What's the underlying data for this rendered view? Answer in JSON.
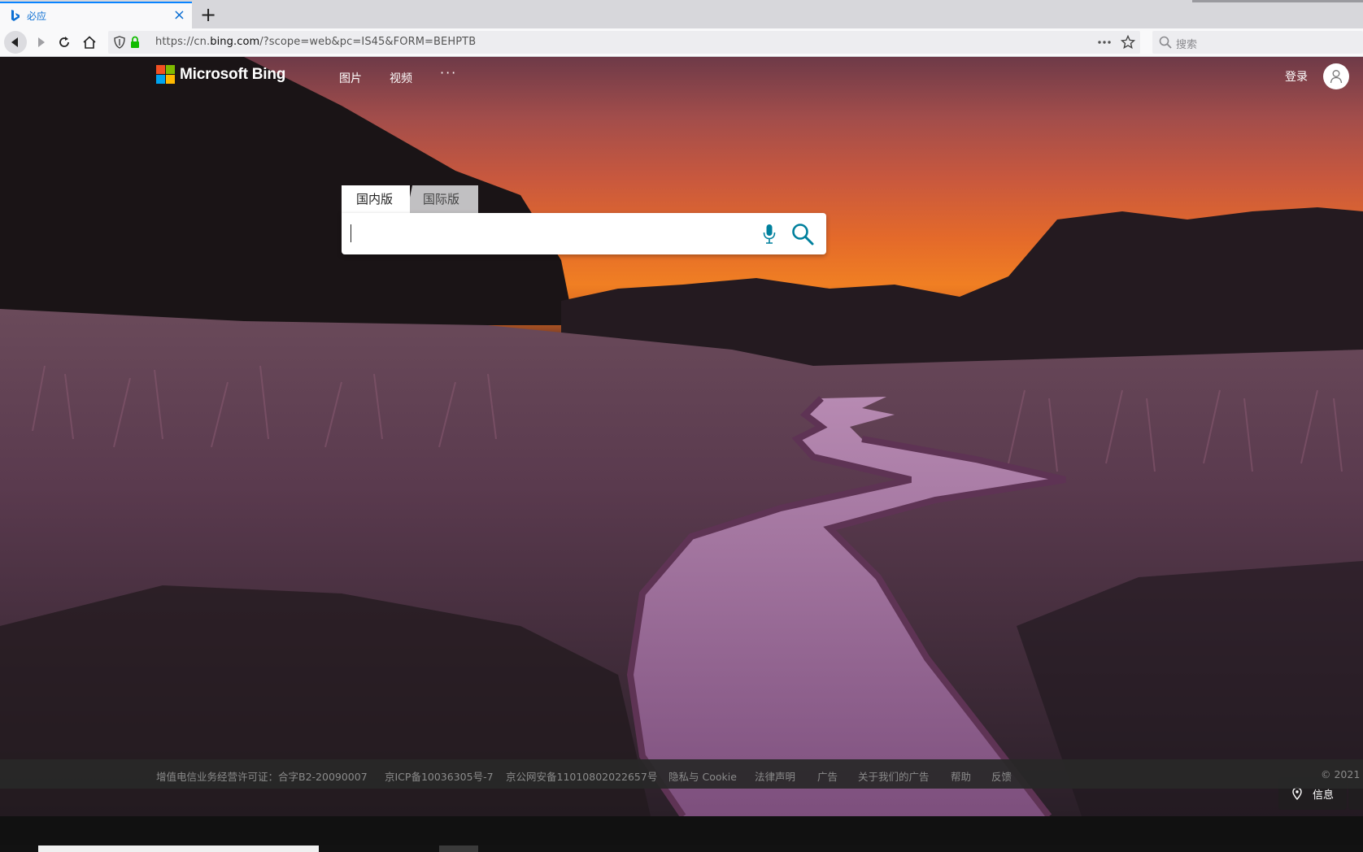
{
  "browser": {
    "tab_title": "必应",
    "tab_close": "×",
    "new_tab": "+",
    "url_prefix": "https://cn.",
    "url_host": "bing.com",
    "url_path": "/?scope=web&pc=IS45&FORM=BEHPTB",
    "search_placeholder": "搜索",
    "accent_color": "#0a84ff"
  },
  "bing": {
    "logo_text": "Microsoft Bing",
    "logo_colors": [
      "#f25022",
      "#7fba00",
      "#00a4ef",
      "#ffb900"
    ],
    "nav": {
      "images": "图片",
      "videos": "视频",
      "more": "···"
    },
    "signin": "登录",
    "scope_tabs": {
      "domestic": "国内版",
      "international": "国际版"
    },
    "search_value": "",
    "accent_color": "#00809d"
  },
  "info_button": "信息",
  "footer": {
    "license": "增值电信业务经营许可证：合字B2-20090007",
    "icp": "京ICP备10036305号-7",
    "police": "京公网安备11010802022657号",
    "privacy": "隐私与 Cookie",
    "legal": "法律声明",
    "ads": "广告",
    "about_ads": "关于我们的广告",
    "help": "帮助",
    "feedback": "反馈",
    "copyright": "© 2021"
  }
}
